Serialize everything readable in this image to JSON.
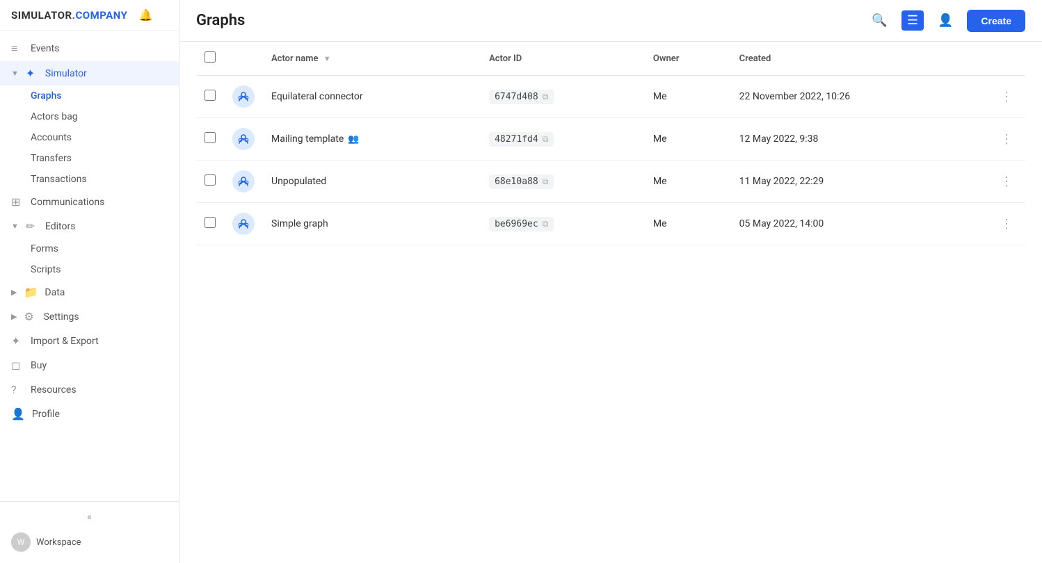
{
  "brand": {
    "simulator": "SIMULATOR",
    "company": ".COMPANY"
  },
  "header": {
    "title": "Graphs",
    "create_label": "Create"
  },
  "sidebar": {
    "nav_items": [
      {
        "id": "events",
        "label": "Events",
        "icon": "≡",
        "expanded": false,
        "active": false
      },
      {
        "id": "simulator",
        "label": "Simulator",
        "icon": "◈",
        "expanded": true,
        "active": true
      }
    ],
    "simulator_children": [
      {
        "id": "graphs",
        "label": "Graphs",
        "active": true
      },
      {
        "id": "actors-bag",
        "label": "Actors bag",
        "active": false
      },
      {
        "id": "accounts",
        "label": "Accounts",
        "active": false
      },
      {
        "id": "transfers",
        "label": "Transfers",
        "active": false
      },
      {
        "id": "transactions",
        "label": "Transactions",
        "active": false
      }
    ],
    "bottom_items": [
      {
        "id": "communications",
        "label": "Communications",
        "icon": "⊞"
      },
      {
        "id": "editors",
        "label": "Editors",
        "icon": "✏",
        "expanded": true
      },
      {
        "id": "forms",
        "label": "Forms",
        "sub": true
      },
      {
        "id": "scripts",
        "label": "Scripts",
        "sub": true
      },
      {
        "id": "data",
        "label": "Data",
        "icon": "📁"
      },
      {
        "id": "settings",
        "label": "Settings",
        "icon": "⚙"
      },
      {
        "id": "import-export",
        "label": "Import & Export",
        "icon": "⚙"
      },
      {
        "id": "buy",
        "label": "Buy",
        "icon": "◻"
      },
      {
        "id": "resources",
        "label": "Resources",
        "icon": "?"
      },
      {
        "id": "profile",
        "label": "Profile",
        "icon": "👤"
      }
    ],
    "collapse_icon": "«",
    "workspace_label": "Workspace"
  },
  "table": {
    "columns": [
      {
        "id": "checkbox",
        "label": ""
      },
      {
        "id": "actor-icon",
        "label": ""
      },
      {
        "id": "actor-name",
        "label": "Actor name",
        "sortable": true
      },
      {
        "id": "actor-id",
        "label": "Actor ID"
      },
      {
        "id": "owner",
        "label": "Owner"
      },
      {
        "id": "created",
        "label": "Created"
      },
      {
        "id": "actions",
        "label": ""
      }
    ],
    "rows": [
      {
        "id": "row1",
        "name": "Equilateral connector",
        "shared": false,
        "actor_id": "6747d408",
        "owner": "Me",
        "created": "22 November 2022, 10:26"
      },
      {
        "id": "row2",
        "name": "Mailing template",
        "shared": true,
        "actor_id": "48271fd4",
        "owner": "Me",
        "created": "12 May 2022, 9:38"
      },
      {
        "id": "row3",
        "name": "Unpopulated",
        "shared": false,
        "actor_id": "68e10a88",
        "owner": "Me",
        "created": "11 May 2022, 22:29"
      },
      {
        "id": "row4",
        "name": "Simple graph",
        "shared": false,
        "actor_id": "be6969ec",
        "owner": "Me",
        "created": "05 May 2022, 14:00"
      }
    ]
  }
}
